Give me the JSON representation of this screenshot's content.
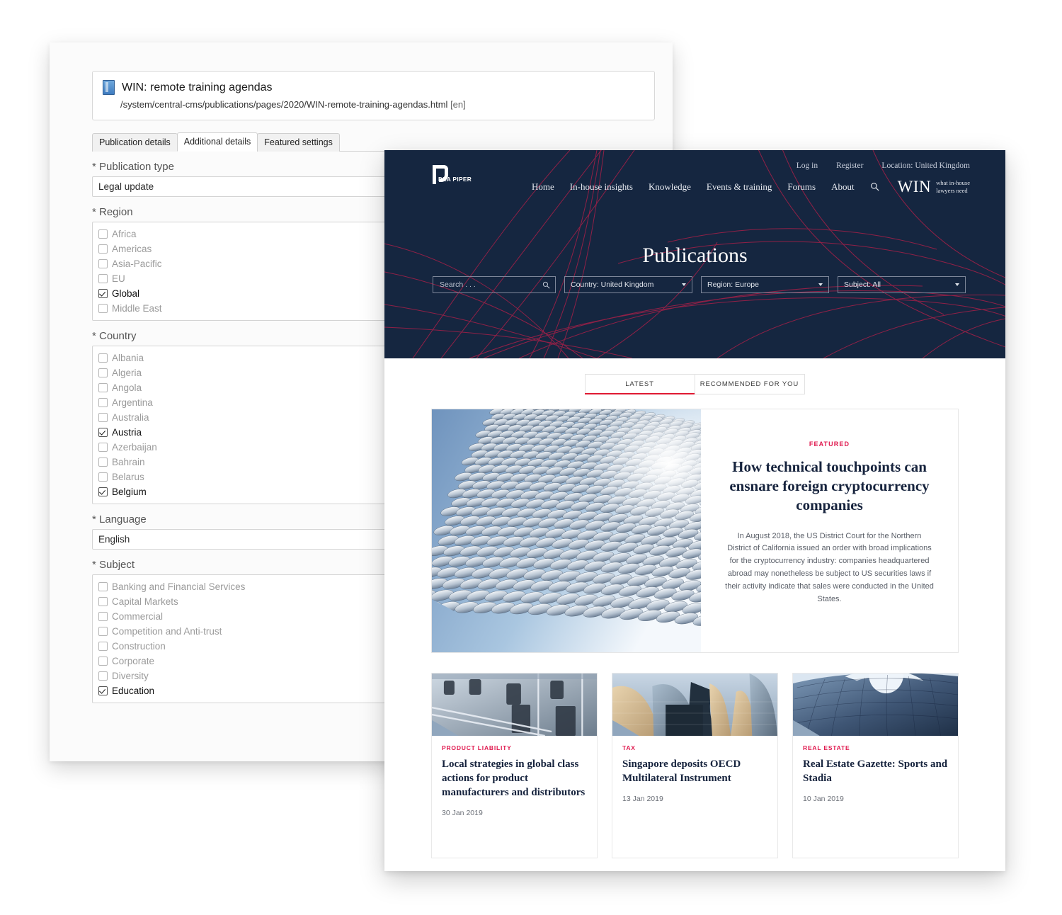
{
  "colors": {
    "navy": "#152640",
    "crimson_line": "#a62048",
    "accent_red": "#e01a33",
    "eyebrow_red": "#e01a4f",
    "heading_navy": "#16233d"
  },
  "cms": {
    "page": {
      "icon": "page-icon",
      "title": "WIN: remote training agendas",
      "path": "/system/central-cms/publications/pages/2020/WIN-remote-training-agendas.html",
      "language_suffix": "[en]"
    },
    "tabs": [
      {
        "label": "Publication details",
        "active": false
      },
      {
        "label": "Additional details",
        "active": true
      },
      {
        "label": "Featured settings",
        "active": false
      }
    ],
    "fields": [
      {
        "type": "text",
        "label": "* Publication type",
        "value": "Legal update"
      },
      {
        "type": "checkbox-group",
        "label": "* Region",
        "options": [
          {
            "label": "Africa",
            "checked": false
          },
          {
            "label": "Americas",
            "checked": false
          },
          {
            "label": "Asia-Pacific",
            "checked": false
          },
          {
            "label": "EU",
            "checked": false
          },
          {
            "label": "Global",
            "checked": true
          },
          {
            "label": "Middle East",
            "checked": false
          }
        ]
      },
      {
        "type": "checkbox-group",
        "label": "* Country",
        "options": [
          {
            "label": "Albania",
            "checked": false
          },
          {
            "label": "Algeria",
            "checked": false
          },
          {
            "label": "Angola",
            "checked": false
          },
          {
            "label": "Argentina",
            "checked": false
          },
          {
            "label": "Australia",
            "checked": false
          },
          {
            "label": "Austria",
            "checked": true
          },
          {
            "label": "Azerbaijan",
            "checked": false
          },
          {
            "label": "Bahrain",
            "checked": false
          },
          {
            "label": "Belarus",
            "checked": false
          },
          {
            "label": "Belgium",
            "checked": true
          }
        ]
      },
      {
        "type": "text",
        "label": "* Language",
        "value": "English"
      },
      {
        "type": "checkbox-group",
        "label": "* Subject",
        "options": [
          {
            "label": "Banking and Financial Services",
            "checked": false
          },
          {
            "label": "Capital Markets",
            "checked": false
          },
          {
            "label": "Commercial",
            "checked": false
          },
          {
            "label": "Competition and Anti-trust",
            "checked": false
          },
          {
            "label": "Construction",
            "checked": false
          },
          {
            "label": "Corporate",
            "checked": false
          },
          {
            "label": "Diversity",
            "checked": false
          },
          {
            "label": "Education",
            "checked": true
          }
        ]
      }
    ]
  },
  "win": {
    "logo": {
      "text": "DLA PIPER",
      "icon": "dla-piper-logo"
    },
    "utility_nav": [
      {
        "label": "Log in"
      },
      {
        "label": "Register"
      },
      {
        "label": "Location: United Kingdom"
      }
    ],
    "main_nav": [
      {
        "label": "Home"
      },
      {
        "label": "In-house insights"
      },
      {
        "label": "Knowledge"
      },
      {
        "label": "Events & training"
      },
      {
        "label": "Forums"
      },
      {
        "label": "About"
      }
    ],
    "search_icon": "search-icon",
    "brand": {
      "word": "WIN",
      "tagline_line1": "what in-house",
      "tagline_line2": "lawyers need"
    },
    "hero_title": "Publications",
    "filters": {
      "search_placeholder": "Search . . .",
      "search_value": "",
      "selects": [
        {
          "label": "Country:",
          "value": "United Kingdom"
        },
        {
          "label": "Region:",
          "value": "Europe"
        },
        {
          "label": "Subject:",
          "value": "All"
        }
      ]
    },
    "view_tabs": [
      {
        "label": "LATEST",
        "active": true
      },
      {
        "label": "RECOMMENDED FOR YOU",
        "active": false
      }
    ],
    "featured": {
      "eyebrow": "FEATURED",
      "title": "How technical touchpoints can ensnare foreign cryptocurrency companies",
      "summary": "In August 2018, the US District Court for the Northern District of California issued an order with broad implications for the cryptocurrency industry: companies headquartered abroad may nonetheless be subject to US securities laws if their activity indicate that sales were conducted in the United States.",
      "image_alt": "curved-disc-facade-building"
    },
    "cards": [
      {
        "eyebrow": "PRODUCT LIABILITY",
        "title": "Local strategies in global class actions for product manufacturers and distributors",
        "date": "30 Jan 2019",
        "image_alt": "factory-production-line"
      },
      {
        "eyebrow": "TAX",
        "title": "Singapore deposits OECD Multilateral Instrument",
        "date": "13 Jan 2019",
        "image_alt": "metallic-curved-architecture"
      },
      {
        "eyebrow": "REAL ESTATE",
        "title": "Real Estate Gazette: Sports and Stadia",
        "date": "10 Jan 2019",
        "image_alt": "curved-glass-stadium-roof"
      }
    ]
  }
}
